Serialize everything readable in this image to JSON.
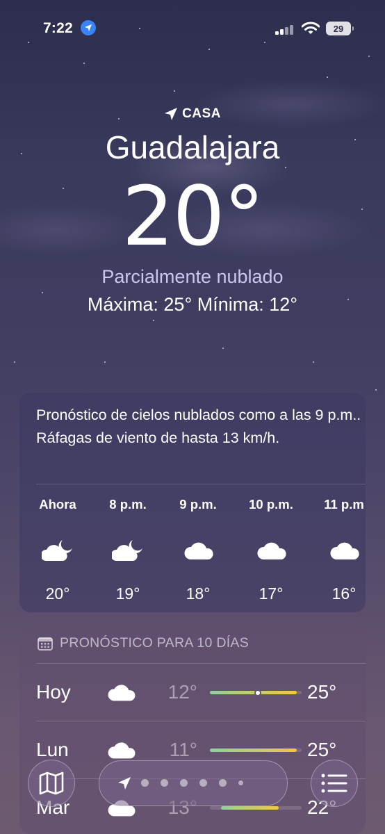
{
  "status_bar": {
    "time": "7:22",
    "battery": "29"
  },
  "header": {
    "location_label": "CASA",
    "city": "Guadalajara",
    "temperature": "20°",
    "condition": "Parcialmente nublado",
    "high_low": "Máxima: 25°  Mínima: 12°"
  },
  "hourly": {
    "summary": "Pronóstico de cielos nublados como a las 9 p.m.. Ráfagas de viento de hasta 13 km/h.",
    "items": [
      {
        "label": "Ahora",
        "icon": "partly-cloudy-night-icon",
        "temp": "20°"
      },
      {
        "label": "8 p.m.",
        "icon": "partly-cloudy-night-icon",
        "temp": "19°"
      },
      {
        "label": "9 p.m.",
        "icon": "cloud-icon",
        "temp": "18°"
      },
      {
        "label": "10 p.m.",
        "icon": "cloud-icon",
        "temp": "17°"
      },
      {
        "label": "11 p.m",
        "icon": "cloud-icon",
        "temp": "16°"
      }
    ]
  },
  "ten_day": {
    "title": "PRONÓSTICO PARA 10 DÍAS",
    "rows": [
      {
        "day": "Hoy",
        "icon": "cloud-icon",
        "low": "12°",
        "high": "25°",
        "bar_start": 0.0,
        "bar_end": 0.95,
        "current": 0.52
      },
      {
        "day": "Lun",
        "icon": "cloud-icon",
        "low": "11°",
        "high": "25°",
        "bar_start": 0.0,
        "bar_end": 0.95
      },
      {
        "day": "Mar",
        "icon": "cloud-icon",
        "low": "13°",
        "high": "22°",
        "bar_start": 0.12,
        "bar_end": 0.75
      }
    ]
  },
  "toolbar": {
    "page_count": 7,
    "current_page": 0
  },
  "colors": {
    "bar_cool": "#8fd0a0",
    "bar_warm": "#f2c740",
    "accent_blue": "#3b82f6",
    "condition_text": "#c9c6f0"
  }
}
